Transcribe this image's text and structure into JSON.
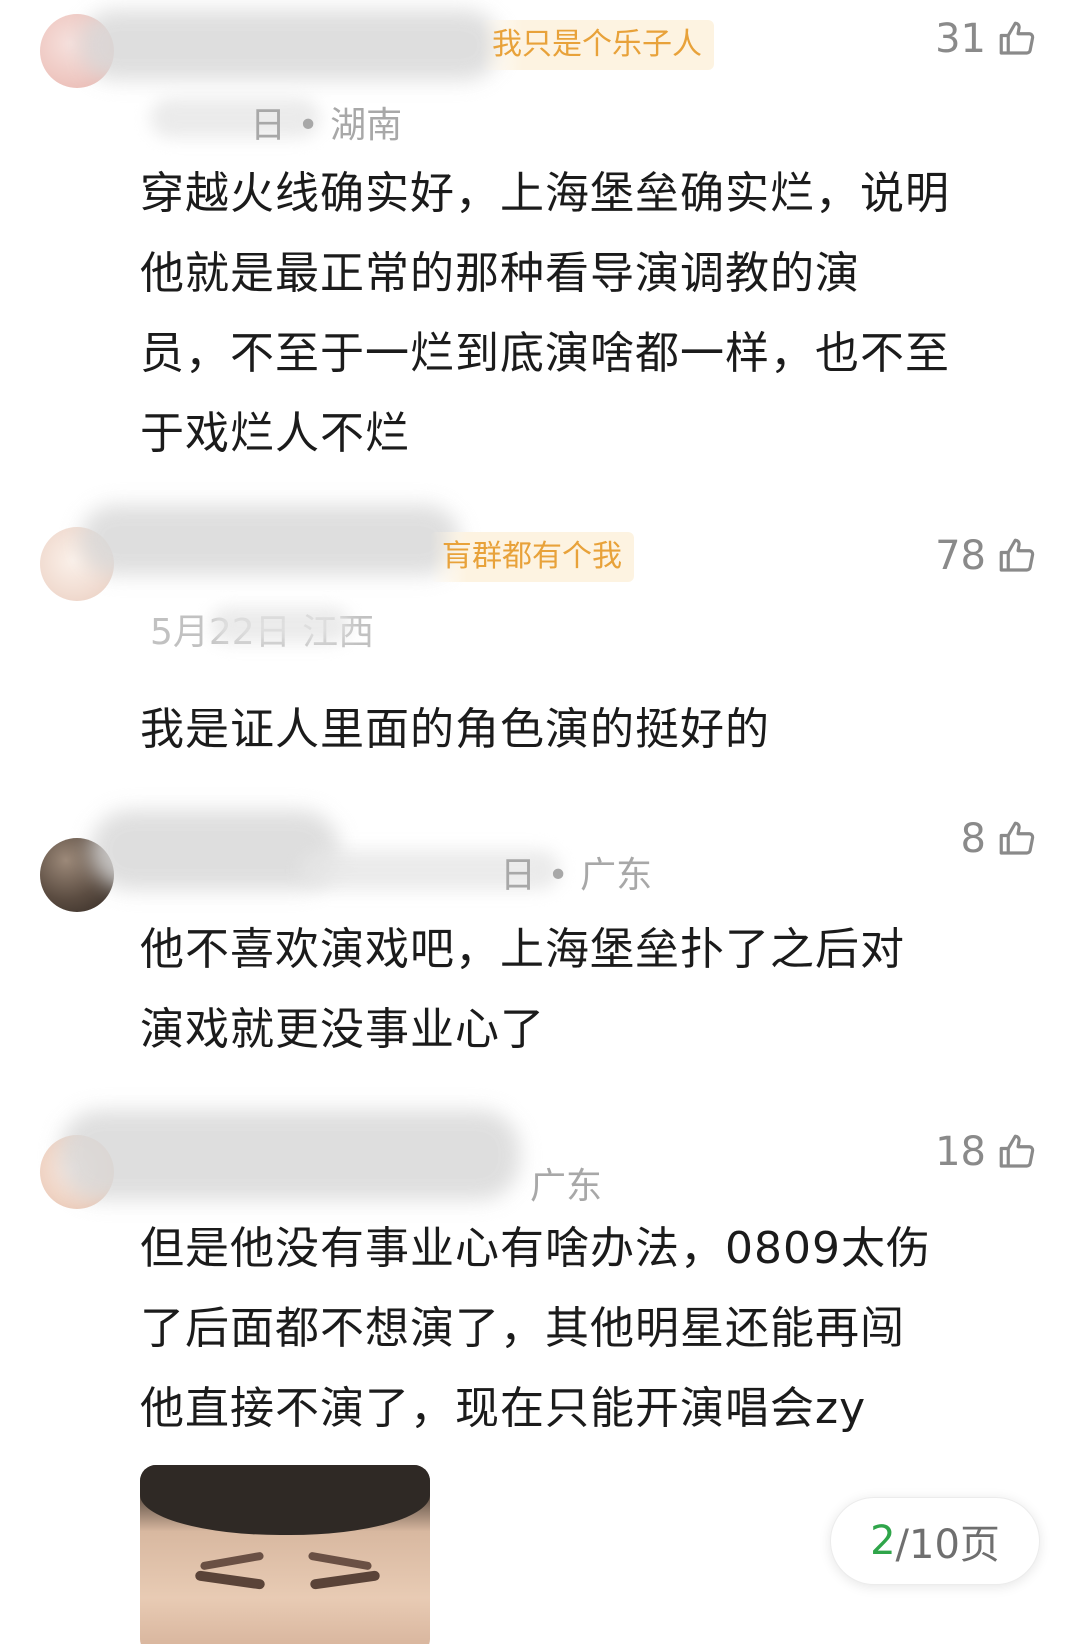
{
  "comments": [
    {
      "badge": "我只是个乐子人",
      "meta": "日 • 湖南",
      "likes": "31",
      "lines": [
        "穿越火线确实好，上海堡垒确实烂，说明",
        "他就是最正常的那种看导演调教的演",
        "员，不至于一烂到底演啥都一样，也不至",
        "于戏烂人不烂"
      ]
    },
    {
      "badge": "肓群都有个我",
      "meta": "5月22日 江西",
      "likes": "78",
      "lines": [
        "我是证人里面的角色演的挺好的"
      ]
    },
    {
      "badge": "",
      "meta": "日 • 广东",
      "likes": "8",
      "lines": [
        "他不喜欢演戏吧，上海堡垒扑了之后对",
        "演戏就更没事业心了"
      ]
    },
    {
      "badge": "",
      "meta": "广东",
      "likes": "18",
      "lines": [
        "但是他没有事业心有啥办法，0809太伤",
        "了后面都不想演了，其他明星还能再闯",
        "他直接不演了，现在只能开演唱会zy"
      ]
    }
  ],
  "pager": {
    "current": "2",
    "rest": "/10页"
  },
  "colors": {
    "badge_text": "#e8a23a",
    "meta_text": "#a8a8a8",
    "pager_current": "#2fa54a"
  },
  "icons": {
    "like": "thumbs-up-icon"
  }
}
